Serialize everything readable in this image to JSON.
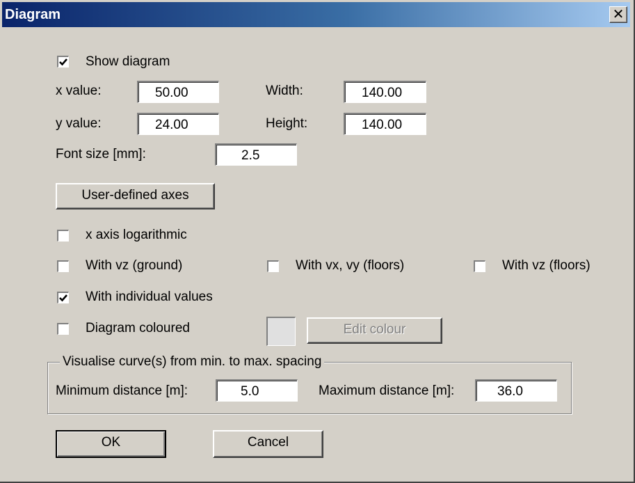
{
  "window": {
    "title": "Diagram",
    "close_glyph": "✕"
  },
  "show_diagram": {
    "label": "Show diagram",
    "checked": true
  },
  "position": {
    "x_label": "x value:",
    "x_value": "50.00",
    "y_label": "y value:",
    "y_value": "24.00",
    "width_label": "Width:",
    "width_value": "140.00",
    "height_label": "Height:",
    "height_value": "140.00"
  },
  "font_size": {
    "label": "Font size [mm]:",
    "value": "2.5"
  },
  "user_axes_button": "User-defined axes",
  "options": {
    "x_log": {
      "label": "x axis logarithmic",
      "checked": false
    },
    "vz_ground": {
      "label": "With vz (ground)",
      "checked": false
    },
    "vxvy_floors": {
      "label": "With vx, vy (floors)",
      "checked": false
    },
    "vz_floors": {
      "label": "With vz (floors)",
      "checked": false
    },
    "individual": {
      "label": "With individual values",
      "checked": true
    },
    "coloured": {
      "label": "Diagram coloured",
      "checked": false
    }
  },
  "colour": {
    "swatch_color": "#e0e0e0",
    "edit_button": "Edit colour",
    "edit_enabled": false
  },
  "spacing_group": {
    "legend": "Visualise curve(s) from min. to max. spacing",
    "min_label": "Minimum distance [m]:",
    "min_value": "5.0",
    "max_label": "Maximum distance [m]:",
    "max_value": "36.0"
  },
  "buttons": {
    "ok": "OK",
    "cancel": "Cancel"
  }
}
